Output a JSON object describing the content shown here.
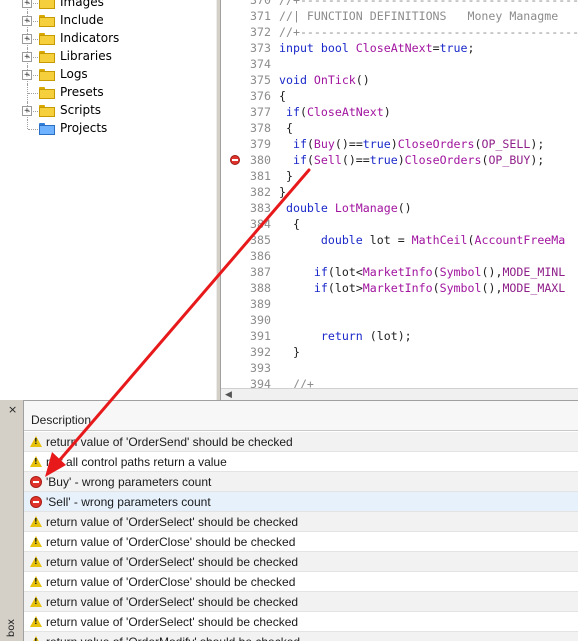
{
  "navigator": {
    "items": [
      {
        "label": "Images",
        "expander": "+",
        "icon": "folder-icon"
      },
      {
        "label": "Include",
        "expander": "+",
        "icon": "folder-icon"
      },
      {
        "label": "Indicators",
        "expander": "+",
        "icon": "folder-icon"
      },
      {
        "label": "Libraries",
        "expander": "+",
        "icon": "folder-icon"
      },
      {
        "label": "Logs",
        "expander": "+",
        "icon": "folder-icon"
      },
      {
        "label": "Presets",
        "expander": "",
        "icon": "folder-icon"
      },
      {
        "label": "Scripts",
        "expander": "+",
        "icon": "folder-icon"
      },
      {
        "label": "Projects",
        "expander": "",
        "icon": "project-folder-icon"
      }
    ]
  },
  "editor": {
    "lines": [
      {
        "num": "370",
        "text": "//+-----------------------------------------------"
      },
      {
        "num": "371",
        "text": "//| FUNCTION DEFINITIONS   Money Managme"
      },
      {
        "num": "372",
        "text": "//+-----------------------------------------------"
      },
      {
        "num": "373",
        "text": "input bool CloseAtNext=true;"
      },
      {
        "num": "374",
        "text": ""
      },
      {
        "num": "375",
        "text": "void OnTick()"
      },
      {
        "num": "376",
        "text": "{"
      },
      {
        "num": "377",
        "text": " if(CloseAtNext)"
      },
      {
        "num": "378",
        "text": " {"
      },
      {
        "num": "379",
        "text": "  if(Buy()==true)CloseOrders(OP_SELL);"
      },
      {
        "num": "380",
        "text": "  if(Sell()==true)CloseOrders(OP_BUY);"
      },
      {
        "num": "381",
        "text": " }"
      },
      {
        "num": "382",
        "text": "}"
      },
      {
        "num": "383",
        "text": " double LotManage()"
      },
      {
        "num": "384",
        "text": "  {"
      },
      {
        "num": "385",
        "text": "      double lot = MathCeil(AccountFreeMa"
      },
      {
        "num": "386",
        "text": ""
      },
      {
        "num": "387",
        "text": "     if(lot<MarketInfo(Symbol(),MODE_MINL"
      },
      {
        "num": "388",
        "text": "     if(lot>MarketInfo(Symbol(),MODE_MAXL"
      },
      {
        "num": "389",
        "text": ""
      },
      {
        "num": "390",
        "text": ""
      },
      {
        "num": "391",
        "text": "      return (lot);"
      },
      {
        "num": "392",
        "text": "  }"
      },
      {
        "num": "393",
        "text": ""
      },
      {
        "num": "394",
        "text": "  //+"
      }
    ],
    "breakpoint_line": "380"
  },
  "toolbox": {
    "close_glyph": "×",
    "side_label": "box",
    "column_header": "Description",
    "rows": [
      {
        "type": "warning",
        "text": "return value of 'OrderSend' should be checked"
      },
      {
        "type": "warning",
        "text": "not all control paths return a value"
      },
      {
        "type": "error",
        "text": "'Buy' - wrong parameters count"
      },
      {
        "type": "error",
        "text": "'Sell' - wrong parameters count"
      },
      {
        "type": "warning",
        "text": "return value of 'OrderSelect' should be checked"
      },
      {
        "type": "warning",
        "text": "return value of 'OrderClose' should be checked"
      },
      {
        "type": "warning",
        "text": "return value of 'OrderSelect' should be checked"
      },
      {
        "type": "warning",
        "text": "return value of 'OrderClose' should be checked"
      },
      {
        "type": "warning",
        "text": "return value of 'OrderSelect' should be checked"
      },
      {
        "type": "warning",
        "text": "return value of 'OrderSelect' should be checked"
      },
      {
        "type": "warning",
        "text": "return value of 'OrderModify' should be checked"
      }
    ],
    "selected_row": 3
  },
  "annotation": {
    "color": "#e8191b"
  }
}
